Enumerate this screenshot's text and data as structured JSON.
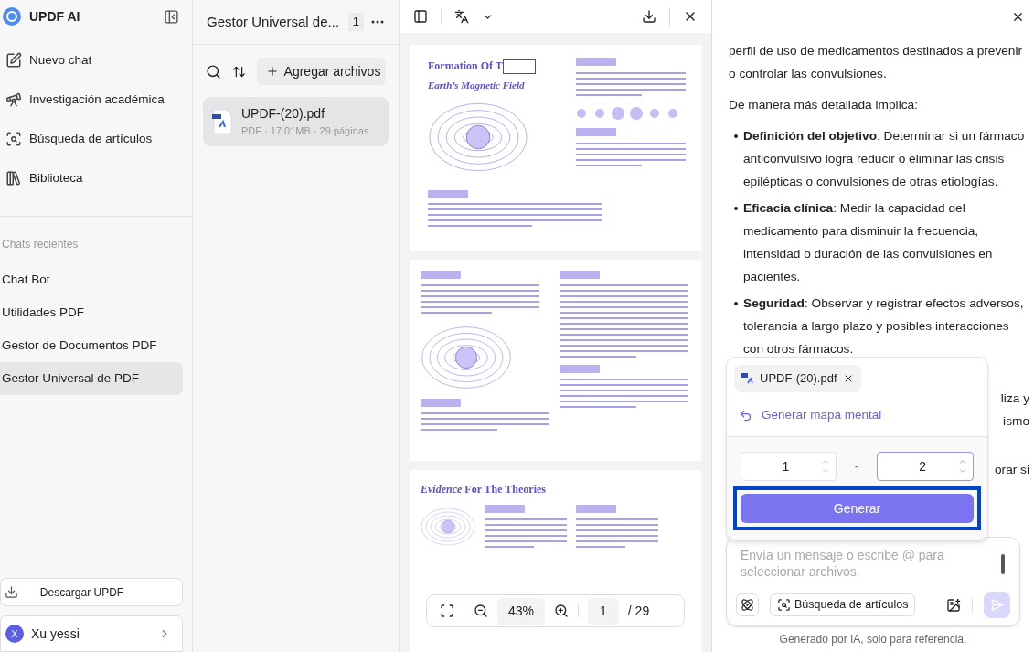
{
  "sidebar": {
    "title": "UPDF AI",
    "nav": [
      {
        "kind": "new",
        "label": "Nuevo chat"
      },
      {
        "kind": "research",
        "label": "Investigación académica"
      },
      {
        "kind": "search",
        "label": "Búsqueda de artículos"
      },
      {
        "kind": "library",
        "label": "Biblioteca"
      }
    ],
    "recent_heading": "Chats recientes",
    "recent_chats": [
      {
        "label": "Chat Bot",
        "selected": false
      },
      {
        "label": "Utilidades PDF",
        "selected": false
      },
      {
        "label": "Gestor de Documentos PDF",
        "selected": false
      },
      {
        "label": "Gestor Universal de PDF",
        "selected": true
      }
    ],
    "download_button": "Descargar UPDF",
    "user": {
      "initial": "X",
      "name": "Xu yessi"
    }
  },
  "file_panel": {
    "title": "Gestor Universal de...",
    "count": "1",
    "add_button": "Agregar archivos",
    "files": [
      {
        "name": "UPDF-(20).pdf",
        "meta": "PDF · 17.01MB · 29 páginas",
        "selected": true
      }
    ]
  },
  "viewer": {
    "pages": [
      {
        "kind": "cover",
        "headings": [
          "Formation Of T",
          "Earth’s Magnetic Field"
        ]
      },
      {
        "kind": "text"
      },
      {
        "kind": "evidence",
        "headings": [
          "*Evidence* For The Theories"
        ]
      }
    ],
    "zoom": "43%",
    "page": "1",
    "total": "/ 29"
  },
  "chat": {
    "paragraphs": [
      "perfil de uso de medicamentos destinados a prevenir o controlar las convulsiones.",
      "De manera más detallada implica:"
    ],
    "bullets": [
      "**Definición del objetivo**: Determinar si un fármaco anticonvulsivo logra reducir o eliminar las crisis epilépticas o convulsiones de otras etiologías.",
      "**Eficacia clínica**: Medir la capacidad del medicamento para disminuir la frecuencia, intensidad o duración de las convulsiones en pacientes.",
      "**Seguridad**: Observar y registrar efectos adversos, tolerancia a largo plazo y posibles interacciones con otros fármacos."
    ],
    "hidden_fragments": [
      "liza y",
      "ismo",
      "orar si"
    ],
    "popup": {
      "file_chip": "UPDF-(20).pdf",
      "action": "Generar mapa mental",
      "from_page": "1",
      "separator": "-",
      "to_page": "2",
      "generate_button": "Generar"
    },
    "input": {
      "placeholder": "Envía un mensaje o escribe @ para seleccionar archivos.",
      "search_chip": "Búsqueda de artículos"
    },
    "footer": "Generado por IA, solo para referencia."
  }
}
